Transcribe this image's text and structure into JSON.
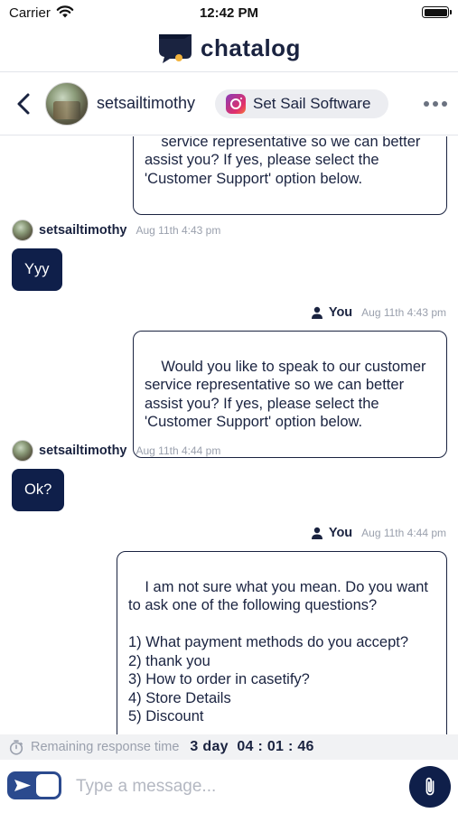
{
  "status_bar": {
    "carrier": "Carrier",
    "time": "12:42 PM"
  },
  "brand": {
    "name": "chatalog",
    "logo_icon": "chatalog-logo-icon",
    "logo_colors": {
      "primary": "#1a2340",
      "accent": "#f2b33d"
    }
  },
  "chat_header": {
    "back_icon": "chevron-left-icon",
    "username": "setsailtimothy",
    "store_label": "Set Sail Software",
    "store_icon": "instagram-icon",
    "more_icon": "more-horizontal-icon"
  },
  "messages": [
    {
      "direction": "out",
      "text": "service representative so we can better\nassist you? If yes, please select the\n'Customer Support' option below."
    },
    {
      "direction": "in",
      "sender": "setsailtimothy",
      "time": "Aug 11th 4:43 pm",
      "text": "Yyy"
    },
    {
      "direction": "out",
      "sender": "You",
      "time": "Aug 11th 4:43 pm",
      "text": "Would you like to speak to our customer\nservice representative so we can better\nassist you? If yes, please select the\n'Customer Support' option below."
    },
    {
      "direction": "in",
      "sender": "setsailtimothy",
      "time": "Aug 11th 4:44 pm",
      "text": "Ok?"
    },
    {
      "direction": "out",
      "sender": "You",
      "time": "Aug 11th 4:44 pm",
      "text": "I am not sure what you mean. Do you want\nto ask one of the following questions?\n\n1) What payment methods do you accept?\n2) thank you\n3) How to order in casetify?\n4) Store Details\n5) Discount"
    }
  ],
  "timer": {
    "icon": "stopwatch-icon",
    "label": "Remaining response time",
    "value": "3 day  04 : 01 : 46"
  },
  "composer": {
    "toggle_icon": "send-toggle-icon",
    "placeholder": "Type a message...",
    "attach_icon": "paperclip-icon"
  },
  "colors": {
    "navy": "#0f1f4a",
    "text": "#1a2340",
    "muted": "#9aa0ad",
    "toggle": "#2b4a8e"
  }
}
